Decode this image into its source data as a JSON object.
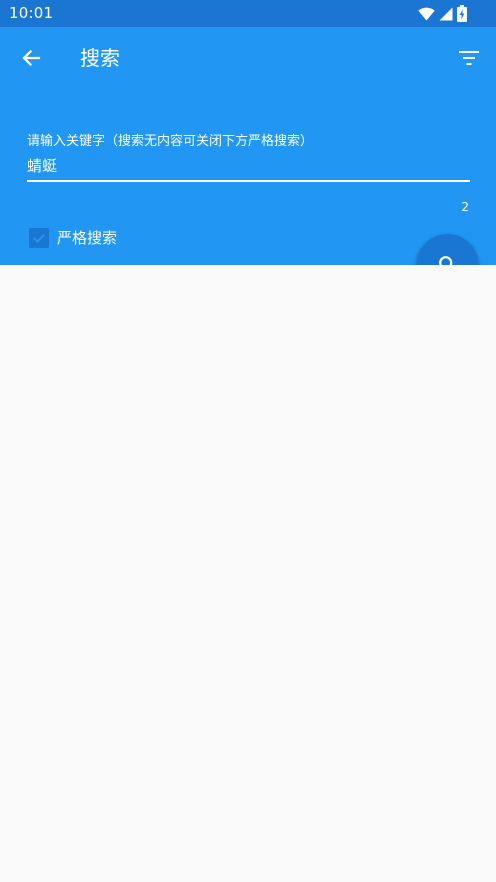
{
  "status_bar": {
    "time": "10:01",
    "icons": [
      "wifi-icon",
      "signal-icon",
      "battery-charging-icon"
    ]
  },
  "app_bar": {
    "title": "搜索",
    "back_icon": "arrow-back-icon",
    "filter_icon": "filter-list-icon"
  },
  "search": {
    "label": "请输入关键字（搜索无内容可关闭下方严格搜索）",
    "value": "蜻蜓",
    "char_count": "2"
  },
  "strict_search": {
    "label": "严格搜索",
    "checked": true
  },
  "fab": {
    "icon": "search-icon"
  },
  "colors": {
    "status_bar": "#1a76d2",
    "app_bar": "#2196f3",
    "accent": "#1976d2",
    "background": "#fafafa"
  }
}
